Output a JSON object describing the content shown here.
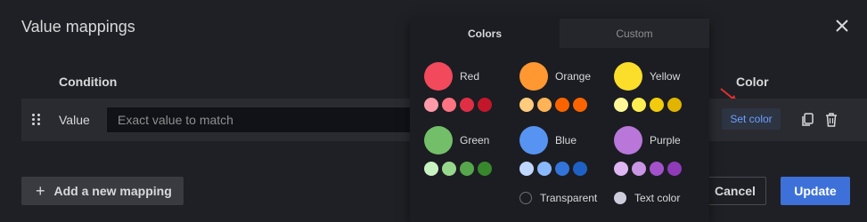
{
  "dialog": {
    "title": "Value mappings",
    "columns": {
      "condition": "Condition",
      "color": "Color"
    },
    "row": {
      "label": "Value",
      "input_placeholder": "Exact value to match",
      "input_value": "",
      "set_color": "Set color"
    },
    "buttons": {
      "add": "Add a new mapping",
      "cancel": "Cancel",
      "update": "Update"
    }
  },
  "picker": {
    "tabs": [
      "Colors",
      "Custom"
    ],
    "active_tab": "Colors",
    "groups": [
      {
        "name": "Red",
        "main": "#f2495c",
        "shades": [
          "#ff9aa8",
          "#ff7383",
          "#e02f44",
          "#c4162a"
        ]
      },
      {
        "name": "Orange",
        "main": "#ff9830",
        "shades": [
          "#ffcb7d",
          "#ffb357",
          "#fa6400",
          "#fa6400"
        ]
      },
      {
        "name": "Yellow",
        "main": "#fade2a",
        "shades": [
          "#fff899",
          "#ffee52",
          "#f2cc0c",
          "#e0b400"
        ]
      },
      {
        "name": "Green",
        "main": "#73bf69",
        "shades": [
          "#c8f2c2",
          "#96d98d",
          "#56a64b",
          "#37872d"
        ]
      },
      {
        "name": "Blue",
        "main": "#5794f2",
        "shades": [
          "#c0d8ff",
          "#8ab8ff",
          "#3274d9",
          "#1f60c4"
        ]
      },
      {
        "name": "Purple",
        "main": "#b877d9",
        "shades": [
          "#deb6f2",
          "#ca95e5",
          "#a352cc",
          "#8f3bb8"
        ]
      }
    ],
    "special": {
      "transparent": "Transparent",
      "text_color": "Text color"
    }
  },
  "colors": {
    "accent": "#3d71d9",
    "set_color_text": "#6e9fff",
    "annotation_arrow": "#e02f2f",
    "text_color_swatch": "#ccccdc"
  }
}
